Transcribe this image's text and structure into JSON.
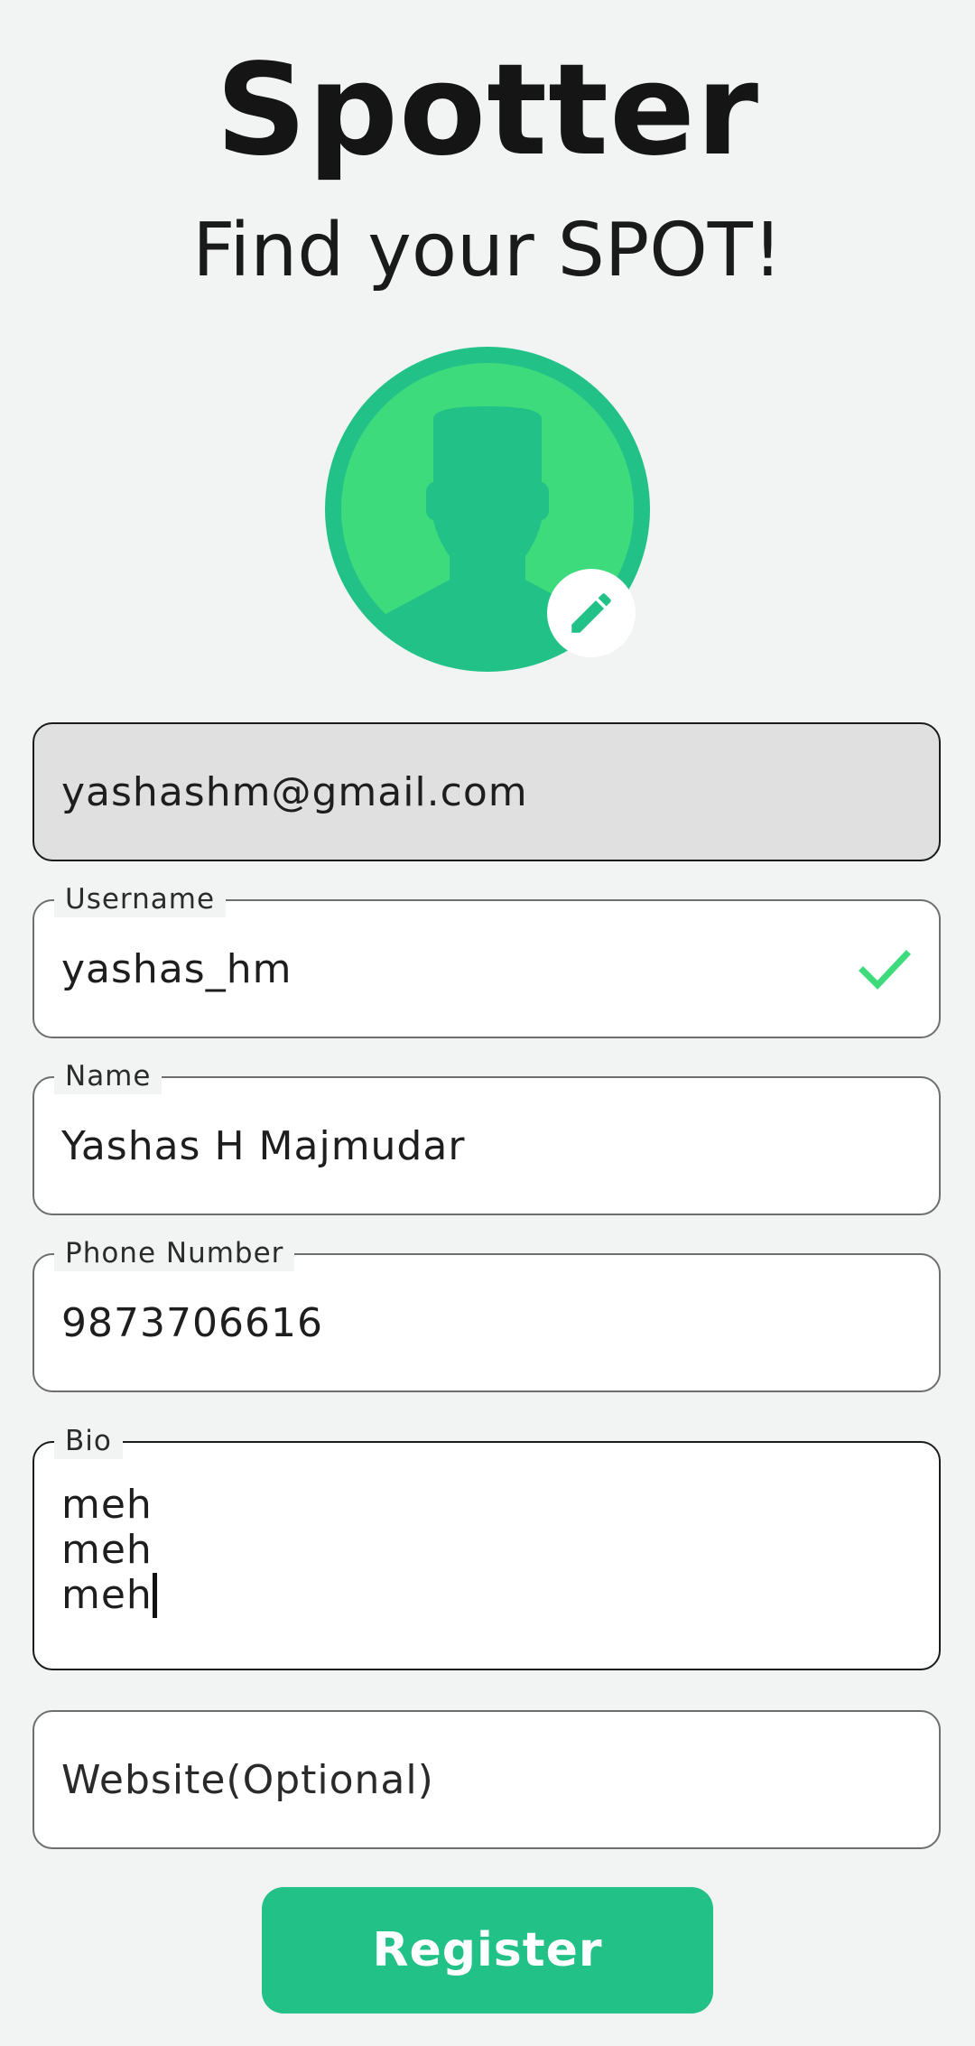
{
  "header": {
    "app_title": "Spotter",
    "tagline": "Find your SPOT!"
  },
  "avatar": {
    "icon": "person-silhouette-icon",
    "edit_icon": "pencil-icon",
    "colors": {
      "ring": "#22c188",
      "inner": "#3ddb7c",
      "silhouette": "#22c188"
    }
  },
  "form": {
    "email": {
      "value": "yashashm@gmail.com"
    },
    "username": {
      "label": "Username",
      "value": "yashas_hm",
      "status_icon": "check-icon"
    },
    "name": {
      "label": "Name",
      "value": "Yashas H Majmudar"
    },
    "phone": {
      "label": "Phone Number",
      "value": "9873706616"
    },
    "bio": {
      "label": "Bio",
      "lines": [
        "meh",
        "meh",
        "meh"
      ]
    },
    "website": {
      "placeholder": "Website(Optional)"
    }
  },
  "actions": {
    "register_label": "Register"
  },
  "colors": {
    "accent": "#22c188",
    "valid": "#3ddb7c",
    "background": "#f2f4f3"
  }
}
